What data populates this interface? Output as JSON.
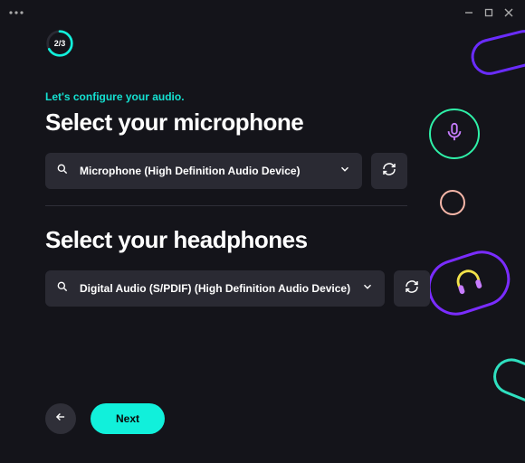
{
  "progress": {
    "label": "2/3",
    "current": 2,
    "total": 3
  },
  "header": {
    "subtitle": "Let's configure your audio."
  },
  "microphone": {
    "title": "Select your microphone",
    "selected": "Microphone (High Definition Audio Device)"
  },
  "headphones": {
    "title": "Select your headphones",
    "selected": "Digital Audio (S/PDIF) (High Definition Audio Device)"
  },
  "footer": {
    "next_label": "Next"
  },
  "colors": {
    "accent_cyan": "#11f0db",
    "accent_purple": "#7a2cff",
    "accent_green": "#2ff0a8",
    "accent_yellow": "#f2e24a",
    "accent_pink": "#f5b6a8"
  }
}
